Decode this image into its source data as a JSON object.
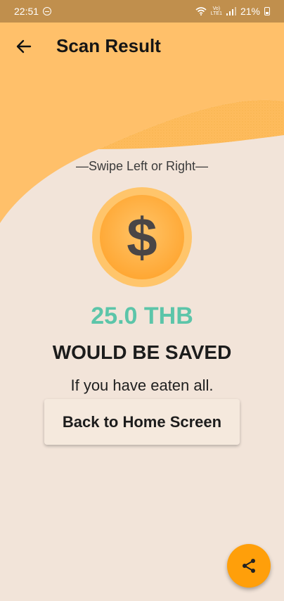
{
  "status_bar": {
    "time": "22:51",
    "volte_top": "Vo)",
    "volte_bottom": "LTE1",
    "battery": "21%"
  },
  "appbar": {
    "title": "Scan Result",
    "back_icon": "arrow-left-icon"
  },
  "main": {
    "swipe_hint": "—Swipe Left or Right—",
    "coin_icon": "dollar-coin-icon",
    "coin_symbol": "$",
    "amount": "25.0 THB",
    "saved_label": "WOULD BE SAVED",
    "condition": "If you have eaten all.",
    "home_button_label": "Back to Home Screen"
  },
  "fab": {
    "icon": "share-icon"
  },
  "colors": {
    "status_bar": "#c08f4d",
    "accent_orange": "#ffb65a",
    "background": "#f2e4d9",
    "amount_teal": "#5cc5a9",
    "fab_orange": "#ff9f0a"
  }
}
